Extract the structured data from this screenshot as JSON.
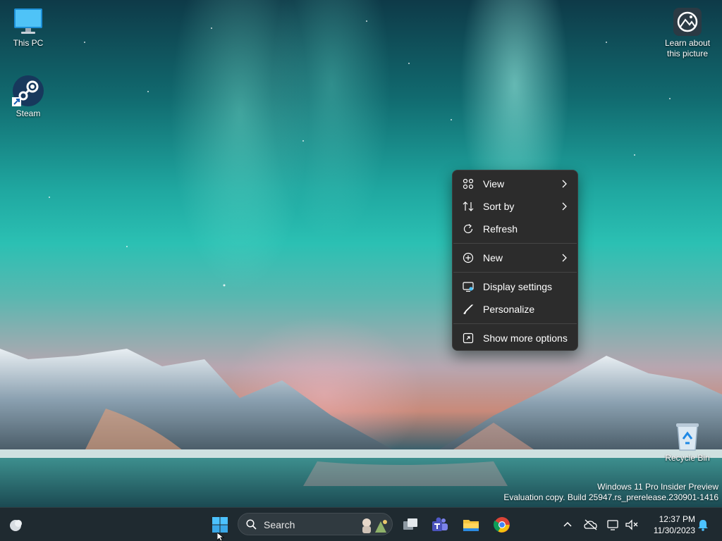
{
  "desktop": {
    "icons": [
      {
        "label": "This PC",
        "icon": "computer-icon"
      },
      {
        "label": "Steam",
        "icon": "steam-icon"
      },
      {
        "label_line1": "Learn about",
        "label_line2": "this picture",
        "icon": "camera-icon"
      },
      {
        "label": "Recycle Bin",
        "icon": "recycle-bin-icon"
      }
    ],
    "watermark": {
      "line1": "Windows 11 Pro Insider Preview",
      "line2": "Evaluation copy. Build 25947.rs_prerelease.230901-1416"
    }
  },
  "context_menu": {
    "items": [
      {
        "label": "View",
        "icon": "grid-view-icon",
        "submenu": true
      },
      {
        "label": "Sort by",
        "icon": "sort-icon",
        "submenu": true
      },
      {
        "label": "Refresh",
        "icon": "refresh-icon",
        "submenu": false
      },
      {
        "label": "New",
        "icon": "plus-circle-icon",
        "submenu": true
      },
      {
        "label": "Display settings",
        "icon": "display-settings-icon",
        "submenu": false
      },
      {
        "label": "Personalize",
        "icon": "brush-icon",
        "submenu": false
      },
      {
        "label": "Show more options",
        "icon": "expand-icon",
        "submenu": false
      }
    ]
  },
  "taskbar": {
    "search_label": "Search",
    "time": "12:37 PM",
    "date": "11/30/2023",
    "apps": [
      "start-icon",
      "task-view-icon",
      "teams-icon",
      "file-explorer-icon",
      "chrome-icon"
    ],
    "colors": {
      "bar": "#1f2a30",
      "accent": "#4cc2ff"
    }
  }
}
